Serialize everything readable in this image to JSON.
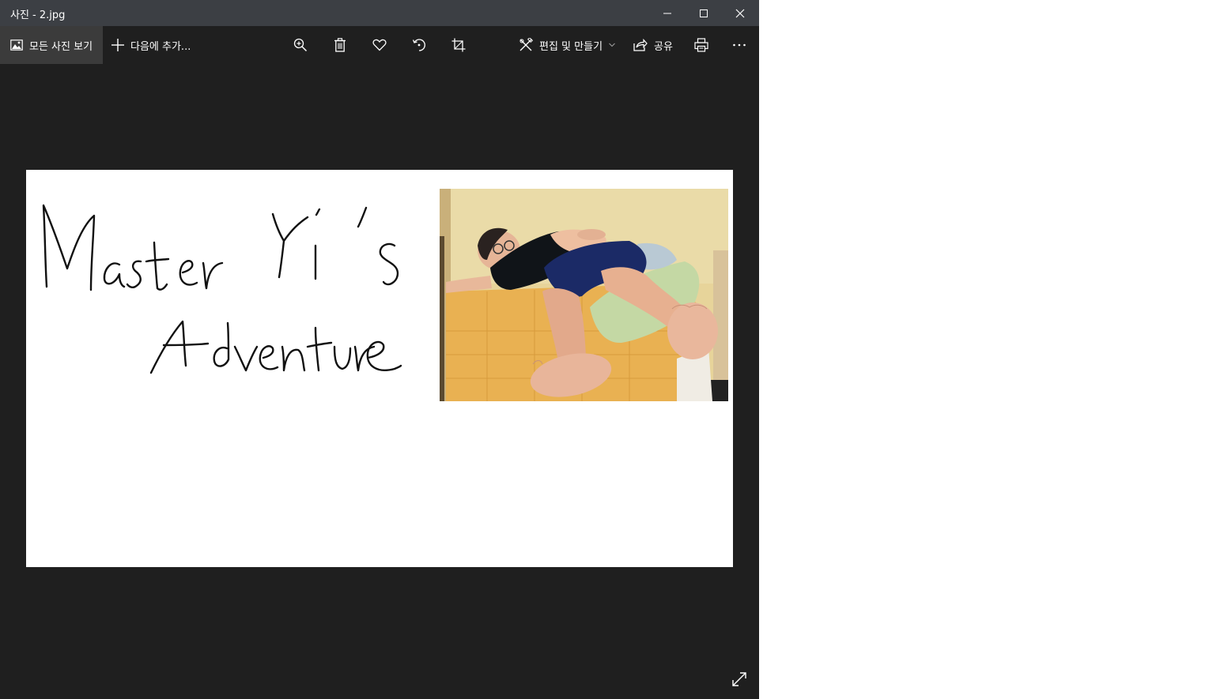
{
  "window": {
    "title": "사진 - 2.jpg"
  },
  "toolbar": {
    "all_photos_label": "모든 사진 보기",
    "add_to_label": "다음에 추가...",
    "edit_create_label": "편집 및 만들기",
    "share_label": "공유",
    "icons": [
      "picture-icon",
      "plus-icon",
      "zoom-icon",
      "delete-icon",
      "heart-icon",
      "rotate-icon",
      "crop-icon",
      "edit-create-icon",
      "chevron-down-icon",
      "share-icon",
      "print-icon",
      "more-icon"
    ]
  },
  "photo": {
    "handwritten_title": "Master Yi's Adventure"
  },
  "colors": {
    "titlebar": "#3c3f44",
    "background": "#1f1f1f",
    "active_button": "#3b3b3b"
  }
}
